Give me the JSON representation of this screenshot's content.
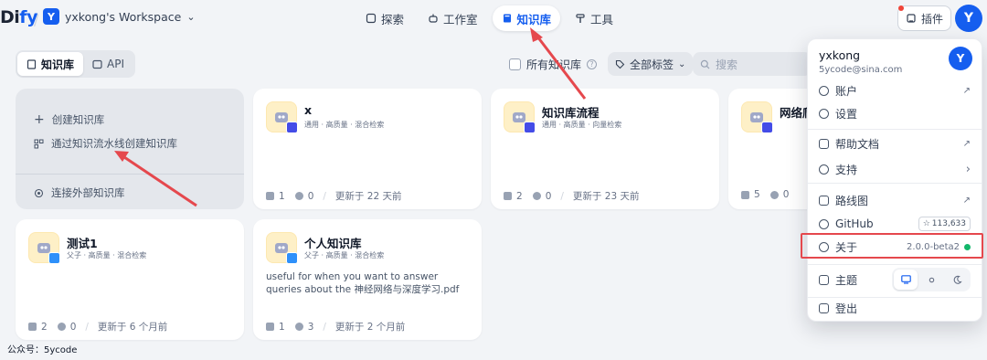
{
  "header": {
    "logo_main": "Di",
    "logo_accent": "fy",
    "workspace_badge": "Y",
    "workspace_name": "yxkong's Workspace",
    "workspace_chevron": "⌄",
    "nav": [
      {
        "label": "探索",
        "icon": "compass-icon"
      },
      {
        "label": "工作室",
        "icon": "robot-icon"
      },
      {
        "label": "知识库",
        "icon": "book-icon",
        "active": true
      },
      {
        "label": "工具",
        "icon": "hammer-icon"
      }
    ],
    "plugin_label": "插件",
    "avatar_initial": "Y"
  },
  "subbar": {
    "tabs": [
      {
        "label": "知识库",
        "active": true
      },
      {
        "label": "API"
      }
    ],
    "all_kb_label": "所有知识库",
    "help_glyph": "?",
    "tag_filter_label": "全部标签",
    "search_placeholder": "搜索"
  },
  "create_card": {
    "create_label": "创建知识库",
    "pipeline_label": "通过知识流水线创建知识库",
    "external_label": "连接外部知识库"
  },
  "cards": [
    {
      "title": "x",
      "meta": "通用 · 高质量 · 混合检索",
      "desc": "",
      "docs": "1",
      "apps": "0",
      "updated": "更新于 22 天前"
    },
    {
      "title": "知识库流程",
      "meta": "通用 · 高质量 · 向量检索",
      "desc": "",
      "docs": "2",
      "apps": "0",
      "updated": "更新于 23 天前"
    },
    {
      "title": "网络爬",
      "meta": "",
      "desc": "",
      "docs": "5",
      "apps": "0",
      "updated": ""
    },
    {
      "title": "测试1",
      "meta": "父子 · 高质量 · 混合检索",
      "desc": "",
      "docs": "2",
      "apps": "0",
      "updated": "更新于 6 个月前"
    },
    {
      "title": "个人知识库",
      "meta": "父子 · 高质量 · 混合检索",
      "desc": "useful for when you want to answer queries about the 神经网络与深度学习.pdf",
      "docs": "1",
      "apps": "3",
      "updated": "更新于 2 个月前"
    }
  ],
  "menu": {
    "name": "yxkong",
    "email": "5ycode@sina.com",
    "avatar": "Y",
    "items": {
      "account": "账户",
      "settings": "设置",
      "docs": "帮助文档",
      "support": "支持",
      "roadmap": "路线图",
      "github": "GitHub",
      "github_stars": "113,633",
      "about": "关于",
      "version": "2.0.0-beta2",
      "theme": "主题",
      "logout": "登出"
    },
    "arrow_out": "↗",
    "chevron_right": "›"
  },
  "footer": {
    "label": "公众号：5ycode"
  },
  "colors": {
    "accent": "#155eef",
    "highlight": "#e5484d",
    "status_green": "#12b76a"
  }
}
